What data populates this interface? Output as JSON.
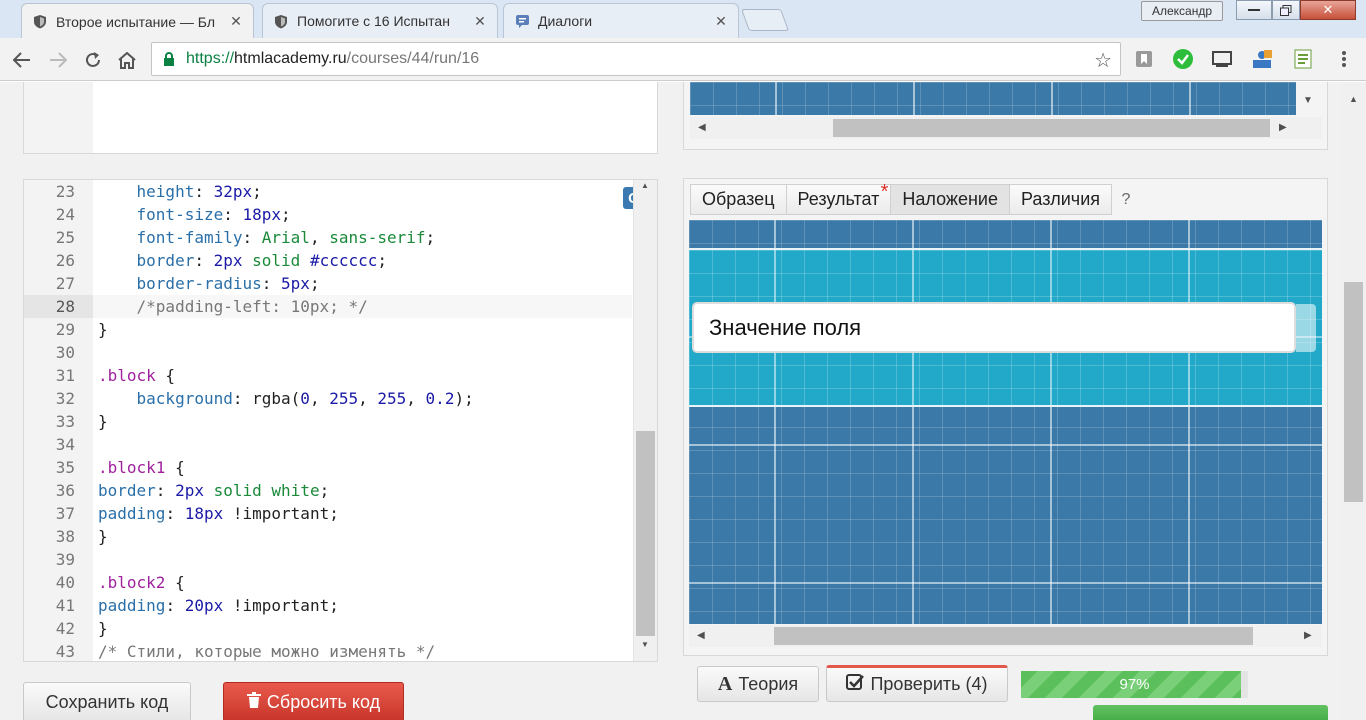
{
  "browser": {
    "tabs": [
      {
        "title": "Второе испытание — Бл",
        "icon": "htmlacademy-shield-icon"
      },
      {
        "title": "Помогите с 16 Испытан",
        "icon": "htmlacademy-shield-icon"
      },
      {
        "title": "Диалоги",
        "icon": "dialog-bubble-icon"
      }
    ],
    "user": "Александр",
    "url": {
      "scheme": "https://",
      "host": "htmlacademy.ru",
      "path": "/courses/44/run/16"
    }
  },
  "editor": {
    "mode_badge": "CSS",
    "lines": [
      {
        "n": "23",
        "t": [
          [
            "    ",
            ""
          ],
          [
            "height",
            "prop"
          ],
          [
            ": ",
            ""
          ],
          [
            "32px",
            "num"
          ],
          [
            ";",
            ""
          ]
        ]
      },
      {
        "n": "24",
        "t": [
          [
            "    ",
            ""
          ],
          [
            "font-size",
            "prop"
          ],
          [
            ": ",
            ""
          ],
          [
            "18px",
            "num"
          ],
          [
            ";",
            ""
          ]
        ]
      },
      {
        "n": "25",
        "t": [
          [
            "    ",
            ""
          ],
          [
            "font-family",
            "prop"
          ],
          [
            ": ",
            ""
          ],
          [
            "Arial",
            "str"
          ],
          [
            ", ",
            ""
          ],
          [
            "sans-serif",
            "str"
          ],
          [
            ";",
            ""
          ]
        ]
      },
      {
        "n": "26",
        "t": [
          [
            "    ",
            ""
          ],
          [
            "border",
            "prop"
          ],
          [
            ": ",
            ""
          ],
          [
            "2px",
            "num"
          ],
          [
            " ",
            ""
          ],
          [
            "solid",
            "val"
          ],
          [
            " ",
            ""
          ],
          [
            "#cccccc",
            "num"
          ],
          [
            ";",
            ""
          ]
        ]
      },
      {
        "n": "27",
        "t": [
          [
            "    ",
            ""
          ],
          [
            "border-radius",
            "prop"
          ],
          [
            ": ",
            ""
          ],
          [
            "5px",
            "num"
          ],
          [
            ";",
            ""
          ]
        ]
      },
      {
        "n": "28",
        "t": [
          [
            "    ",
            ""
          ],
          [
            "/*padding-left: 10px; */",
            "com"
          ]
        ],
        "active": true
      },
      {
        "n": "29",
        "t": [
          [
            "}",
            ""
          ]
        ]
      },
      {
        "n": "30",
        "t": []
      },
      {
        "n": "31",
        "t": [
          [
            ".block",
            "sel"
          ],
          [
            " {",
            ""
          ]
        ]
      },
      {
        "n": "32",
        "t": [
          [
            "    ",
            ""
          ],
          [
            "background",
            "prop"
          ],
          [
            ": rgba(",
            ""
          ],
          [
            "0",
            "num"
          ],
          [
            ", ",
            ""
          ],
          [
            "255",
            "num"
          ],
          [
            ", ",
            ""
          ],
          [
            "255",
            "num"
          ],
          [
            ", ",
            ""
          ],
          [
            "0.2",
            "num"
          ],
          [
            ");",
            ""
          ]
        ]
      },
      {
        "n": "33",
        "t": [
          [
            "}",
            ""
          ]
        ]
      },
      {
        "n": "34",
        "t": []
      },
      {
        "n": "35",
        "t": [
          [
            ".block1",
            "sel"
          ],
          [
            " {",
            ""
          ]
        ]
      },
      {
        "n": "36",
        "t": [
          [
            "border",
            "prop"
          ],
          [
            ": ",
            ""
          ],
          [
            "2px",
            "num"
          ],
          [
            " ",
            ""
          ],
          [
            "solid",
            "val"
          ],
          [
            " ",
            ""
          ],
          [
            "white",
            "val"
          ],
          [
            ";",
            ""
          ]
        ]
      },
      {
        "n": "37",
        "t": [
          [
            "padding",
            "prop"
          ],
          [
            ": ",
            ""
          ],
          [
            "18px",
            "num"
          ],
          [
            " ",
            ""
          ],
          [
            "!important",
            "imp"
          ],
          [
            ";",
            ""
          ]
        ]
      },
      {
        "n": "38",
        "t": [
          [
            "}",
            ""
          ]
        ]
      },
      {
        "n": "39",
        "t": []
      },
      {
        "n": "40",
        "t": [
          [
            ".block2",
            "sel"
          ],
          [
            " {",
            ""
          ]
        ]
      },
      {
        "n": "41",
        "t": [
          [
            "padding",
            "prop"
          ],
          [
            ": ",
            ""
          ],
          [
            "20px",
            "num"
          ],
          [
            " ",
            ""
          ],
          [
            "!important",
            "imp"
          ],
          [
            ";",
            ""
          ]
        ]
      },
      {
        "n": "42",
        "t": [
          [
            "}",
            ""
          ]
        ]
      },
      {
        "n": "43",
        "t": [
          [
            "/* Стили, которые можно изменять */",
            "com"
          ]
        ]
      }
    ]
  },
  "buttons": {
    "save": "Сохранить код",
    "reset": "Сбросить код",
    "theory": "Теория",
    "check": "Проверить (4)"
  },
  "preview": {
    "tabs": [
      "Образец",
      "Результат",
      "Наложение",
      "Различия"
    ],
    "active_tab": "Наложение",
    "modified_tab": "Результат",
    "help": "?",
    "field_value": "Значение поля"
  },
  "progress": {
    "label": "97%",
    "value": 0.97
  },
  "colors": {
    "grid": "#3a79a8",
    "band": "#22a8c8",
    "reset": "#d9453a",
    "check_accent": "#e4574b",
    "progress": "#5bc05b"
  }
}
